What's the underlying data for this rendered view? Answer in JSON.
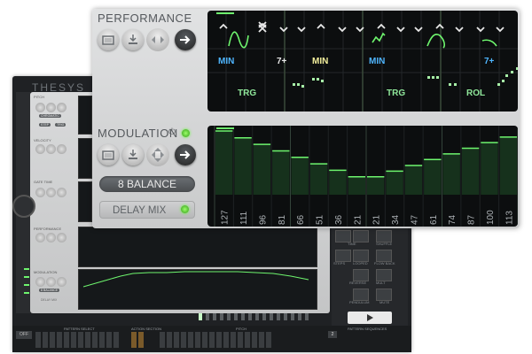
{
  "background_device": {
    "logo": "THESYS",
    "sections": [
      "PITCH",
      "VELOCITY",
      "GATE TIME",
      "PERFORMANCE",
      "MODULATION"
    ],
    "pitch_chips": [
      "CHROMATIC",
      "STEP",
      "TRIG"
    ],
    "mod_value": "8 BALANCE",
    "mod_delay": "DELAY MIX",
    "right_labels": [
      "TIME",
      "GATE",
      "SHUFFLE",
      "STEPS",
      "LOOPED",
      "FLOW BACK",
      "PLAY ONCE",
      "REVERSE",
      "MULT",
      "REPS",
      "PENDULUM",
      "MUTE"
    ],
    "bottom_labels": {
      "off": "OFF",
      "pattern_select": "PATTERN SELECT",
      "action_section": "ACTION SECTION",
      "pitch": "PITCH",
      "pattern_sequences": "PATTERN SEQUENCES",
      "count": "2"
    }
  },
  "performance": {
    "title": "PERFORMANCE",
    "buttons": [
      "folder-icon",
      "download-icon",
      "left-right-icon",
      "arrow-right-icon"
    ]
  },
  "performance_grid": {
    "chord_labels": [
      "MIN",
      "7+",
      "MIN",
      "MIN",
      "7+"
    ],
    "trig_labels": [
      "TRG",
      "TRG",
      "ROL"
    ]
  },
  "modulation": {
    "title": "MODULATION",
    "balance_value": "8 BALANCE",
    "delay_mix_label": "DELAY MIX"
  },
  "chart_data": {
    "type": "bar",
    "title": "",
    "categories": [
      "127",
      "111",
      "96",
      "81",
      "66",
      "51",
      "36",
      "21",
      "21",
      "34",
      "47",
      "61",
      "74",
      "87",
      "100",
      "113"
    ],
    "values": [
      127,
      111,
      96,
      81,
      66,
      51,
      36,
      21,
      21,
      34,
      47,
      61,
      74,
      87,
      100,
      113
    ],
    "ylim": [
      0,
      127
    ]
  },
  "colors": {
    "accent_green": "#6ef56e",
    "chord_blue": "#4fb6ff",
    "chord_yellow": "#f3ef9c",
    "trig_green": "#8fe79a",
    "panel_silver": "#d2d3d4",
    "grid_black": "#0c0e0f"
  }
}
